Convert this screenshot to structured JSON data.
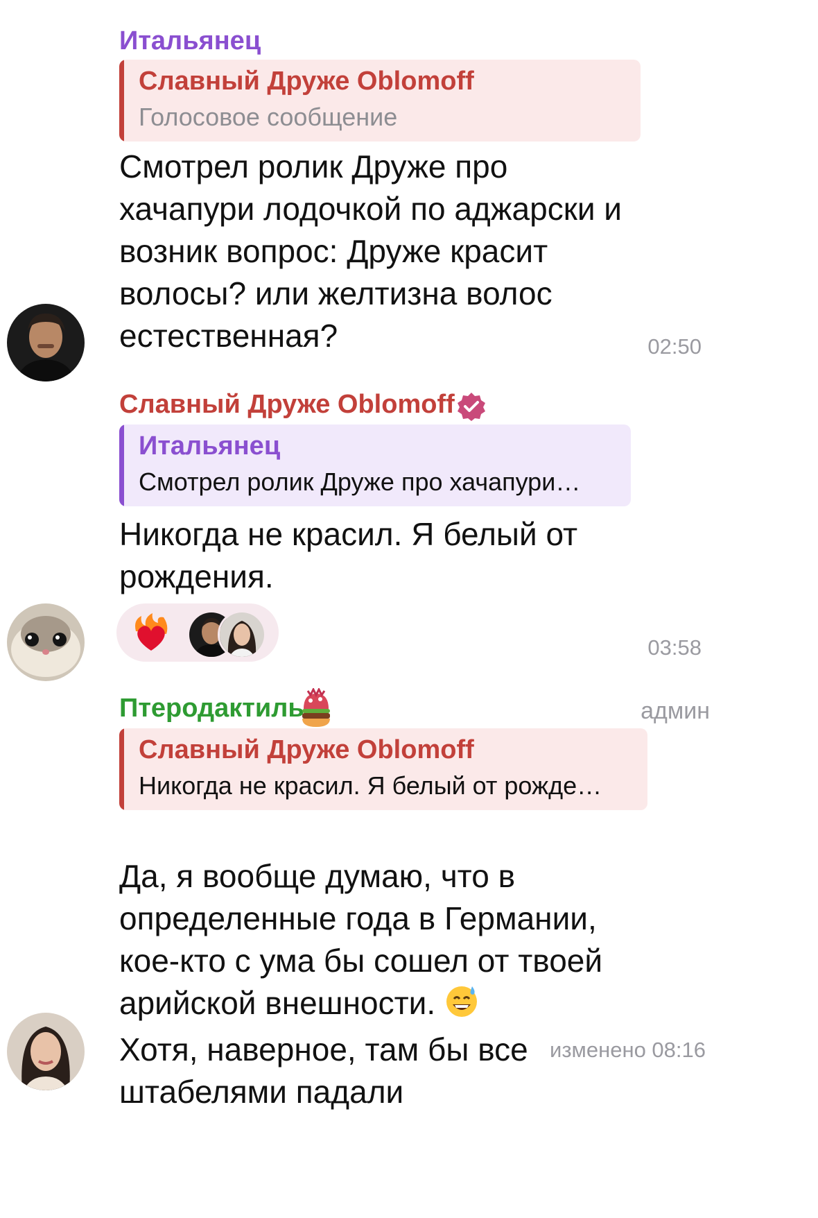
{
  "messages": [
    {
      "sender": "Итальянец",
      "reply": {
        "name": "Славный Друже Oblomoff",
        "text": "Голосовое сообщение"
      },
      "text": "Смотрел ролик Друже про\nхачапури лодочкой по аджарски и\nвозник вопрос: Друже красит\nволосы? или желтизна волос\nестественная?",
      "time": "02:50",
      "avatar_icon": "man-portrait-avatar"
    },
    {
      "sender": "Славный Друже Oblomoff",
      "verified": true,
      "reply": {
        "name": "Итальянец",
        "text": "Смотрел ролик Друже про хачапури…"
      },
      "text": "Никогда не красил. Я белый от\nрождения.",
      "reaction": {
        "emoji": "heart-on-fire"
      },
      "time": "03:58",
      "avatar_icon": "hamster-avatar"
    },
    {
      "sender": "Птеродактиль",
      "sender_emoji": "burger-emoji",
      "badge": "админ",
      "reply": {
        "name": "Славный Друже Oblomoff",
        "text": "Никогда не красил. Я белый от рожде…"
      },
      "text_line1": "Да, я вообще думаю, что в\nопределенные года в Германии,\nкое-кто с ума бы сошел от твоей\nарийской внешности. ",
      "text_line2": "Хотя, наверное, там бы все\nштабелями падали",
      "time": "изменено 08:16",
      "avatar_icon": "woman-portrait-avatar"
    }
  ],
  "colors": {
    "purple": "#8a4fd0",
    "red": "#c2403a",
    "green": "#2e9b32",
    "reply_red_bg": "#fbe9e9",
    "reply_purple_bg": "#f1e9fb"
  }
}
